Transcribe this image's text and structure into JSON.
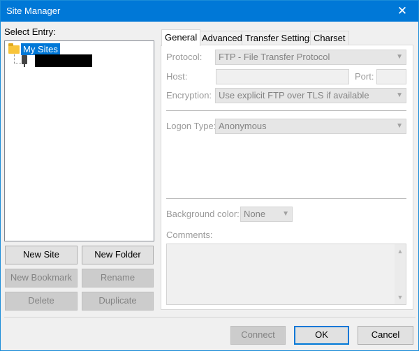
{
  "window": {
    "title": "Site Manager",
    "close_glyph": "✕"
  },
  "left": {
    "select_entry_label": "Select Entry:",
    "tree": {
      "root_label": "My Sites"
    },
    "buttons": {
      "new_site": "New Site",
      "new_folder": "New Folder",
      "new_bookmark": "New Bookmark",
      "rename": "Rename",
      "delete": "Delete",
      "duplicate": "Duplicate"
    }
  },
  "tabs": [
    "General",
    "Advanced",
    "Transfer Settings",
    "Charset"
  ],
  "general": {
    "protocol_label": "Protocol:",
    "protocol_value": "FTP - File Transfer Protocol",
    "host_label": "Host:",
    "host_value": "",
    "port_label": "Port:",
    "port_value": "",
    "encryption_label": "Encryption:",
    "encryption_value": "Use explicit FTP over TLS if available",
    "logon_type_label": "Logon Type:",
    "logon_type_value": "Anonymous",
    "background_color_label": "Background color:",
    "background_color_value": "None",
    "comments_label": "Comments:"
  },
  "footer": {
    "connect": "Connect",
    "ok": "OK",
    "cancel": "Cancel"
  },
  "icons": {
    "folder": "folder-icon",
    "server": "server-icon",
    "dropdown": "chevron-down-icon",
    "close": "close-icon"
  },
  "colors": {
    "accent": "#0078d7",
    "disabled_text": "#838383"
  }
}
